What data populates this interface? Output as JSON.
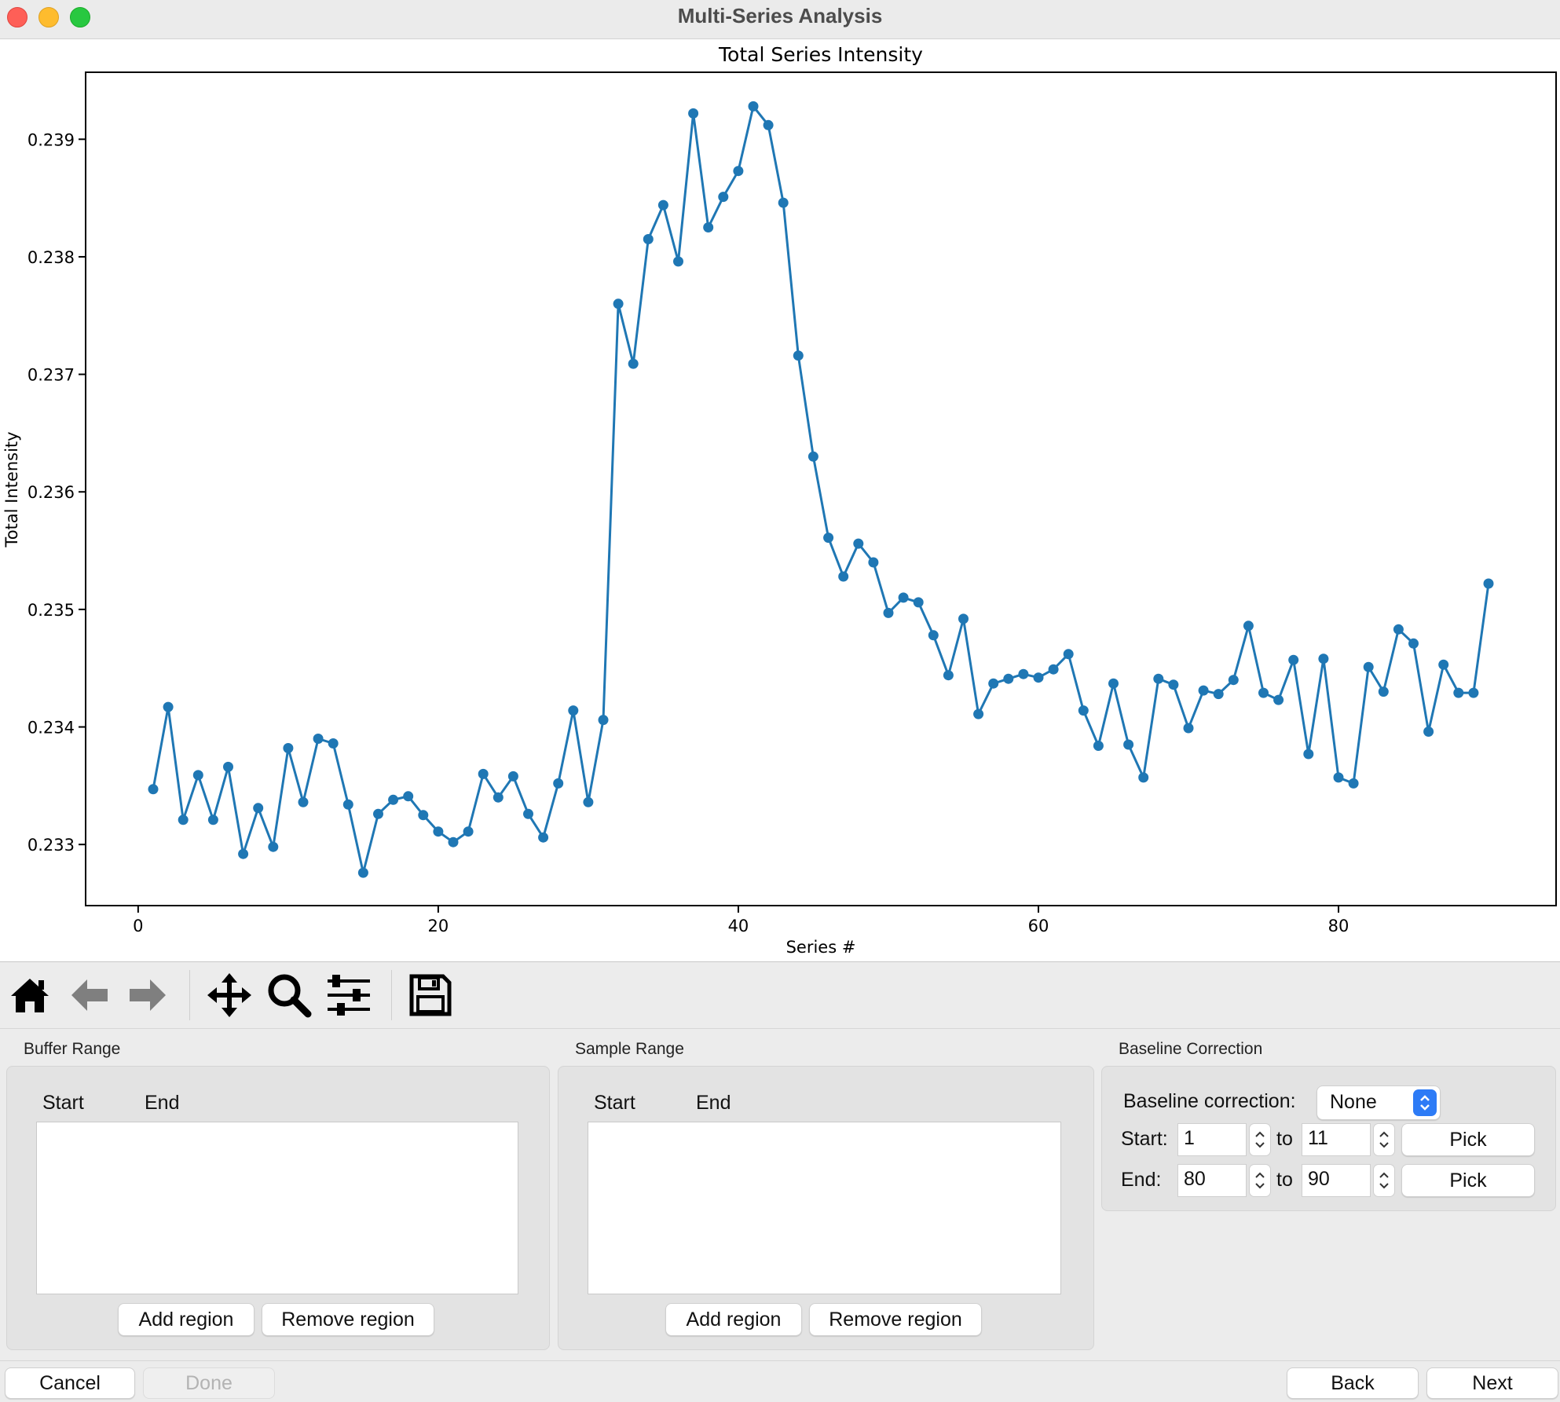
{
  "window": {
    "title": "Multi-Series Analysis"
  },
  "chart_data": {
    "type": "line",
    "title": "Total Series Intensity",
    "xlabel": "Series #",
    "ylabel": "Total Intensity",
    "xlim": [
      -3.5,
      94.5
    ],
    "ylim": [
      0.23248,
      0.23957
    ],
    "xticks": [
      0,
      20,
      40,
      60,
      80
    ],
    "xtick_labels": [
      "0",
      "20",
      "40",
      "60",
      "80"
    ],
    "yticks": [
      0.233,
      0.234,
      0.235,
      0.236,
      0.237,
      0.238,
      0.239
    ],
    "ytick_labels": [
      "0.233",
      "0.234",
      "0.235",
      "0.236",
      "0.237",
      "0.238",
      "0.239"
    ],
    "grid": false,
    "color": "#1f77b4",
    "series": [
      {
        "x": [
          1,
          2,
          3,
          4,
          5,
          6,
          7,
          8,
          9,
          10,
          11,
          12,
          13,
          14,
          15,
          16,
          17,
          18,
          19,
          20,
          21,
          22,
          23,
          24,
          25,
          26,
          27,
          28,
          29,
          30,
          31,
          32,
          33,
          34,
          35,
          36,
          37,
          38,
          39,
          40,
          41,
          42,
          43,
          44,
          45,
          46,
          47,
          48,
          49,
          50,
          51,
          52,
          53,
          54,
          55,
          56,
          57,
          58,
          59,
          60,
          61,
          62,
          63,
          64,
          65,
          66,
          67,
          68,
          69,
          70,
          71,
          72,
          73,
          74,
          75,
          76,
          77,
          78,
          79,
          80,
          81,
          82,
          83,
          84,
          85,
          86,
          87,
          88,
          89,
          90
        ],
        "values": [
          0.23347,
          0.23417,
          0.23321,
          0.23359,
          0.23321,
          0.23366,
          0.23292,
          0.23331,
          0.23298,
          0.23382,
          0.23336,
          0.2339,
          0.23386,
          0.23334,
          0.23276,
          0.23326,
          0.23338,
          0.23341,
          0.23325,
          0.23311,
          0.23302,
          0.23311,
          0.2336,
          0.2334,
          0.23358,
          0.23326,
          0.23306,
          0.23352,
          0.23414,
          0.23336,
          0.23406,
          0.2376,
          0.23709,
          0.23815,
          0.23844,
          0.23796,
          0.23922,
          0.23825,
          0.23851,
          0.23873,
          0.23928,
          0.23912,
          0.23846,
          0.23716,
          0.2363,
          0.23561,
          0.23528,
          0.23556,
          0.2354,
          0.23497,
          0.2351,
          0.23506,
          0.23478,
          0.23444,
          0.23492,
          0.23411,
          0.23437,
          0.23441,
          0.23445,
          0.23442,
          0.23449,
          0.23462,
          0.23414,
          0.23384,
          0.23437,
          0.23385,
          0.23357,
          0.23441,
          0.23436,
          0.23399,
          0.23431,
          0.23428,
          0.2344,
          0.23486,
          0.23429,
          0.23423,
          0.23457,
          0.23377,
          0.23458,
          0.23357,
          0.23352,
          0.23451,
          0.2343,
          0.23483,
          0.23471,
          0.23396,
          0.23453,
          0.23429,
          0.23429,
          0.23522
        ]
      }
    ]
  },
  "toolbar": {
    "icons": [
      "home-icon",
      "back-arrow-icon",
      "forward-arrow-icon",
      "pan-icon",
      "zoom-icon",
      "configure-subplots-icon",
      "save-icon"
    ]
  },
  "buffer_range": {
    "label": "Buffer Range",
    "col_start": "Start",
    "col_end": "End",
    "add_label": "Add region",
    "remove_label": "Remove region"
  },
  "sample_range": {
    "label": "Sample Range",
    "col_start": "Start",
    "col_end": "End",
    "add_label": "Add region",
    "remove_label": "Remove region"
  },
  "baseline": {
    "label": "Baseline Correction",
    "correction_label": "Baseline correction:",
    "correction_value": "None",
    "start_label": "Start:",
    "start_from": "1",
    "start_to": "11",
    "end_label": "End:",
    "end_from": "80",
    "end_to": "90",
    "to_label": "to",
    "pick_label": "Pick"
  },
  "footer": {
    "cancel_label": "Cancel",
    "done_label": "Done",
    "back_label": "Back",
    "next_label": "Next"
  }
}
